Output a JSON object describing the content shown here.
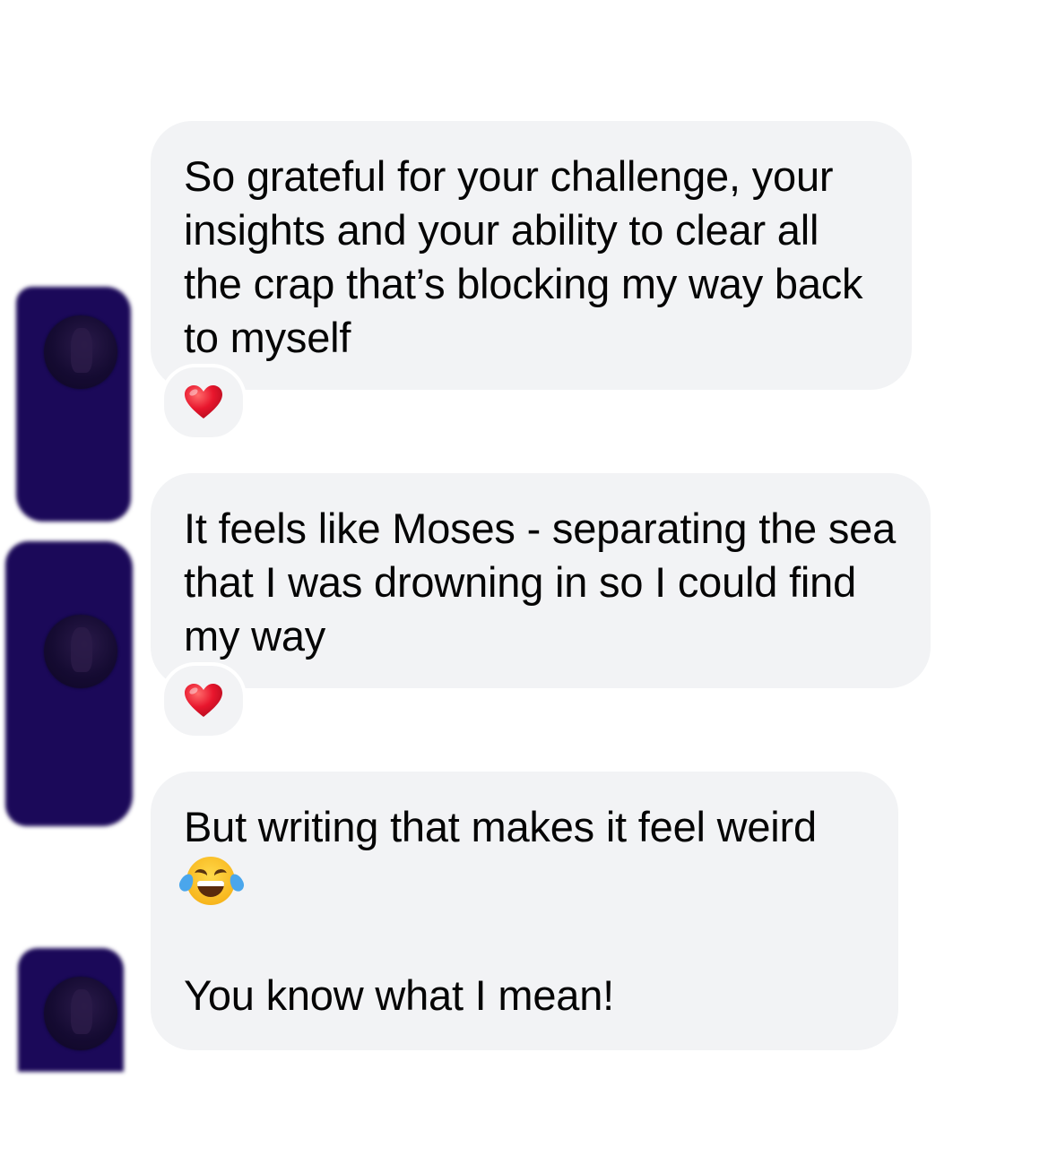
{
  "messages": [
    {
      "text": "So grateful for your challenge, your insights and your ability to clear all the crap that’s blocking my way back to myself",
      "reaction": "heart-icon"
    },
    {
      "text": "It feels like Moses - separating the sea that I was drowning in so I could find my way",
      "reaction": "heart-icon"
    },
    {
      "text_line1": "But writing that makes it feel weird",
      "emoji": "laughing-tears-icon",
      "text_line2": "You know what I mean!"
    }
  ],
  "colors": {
    "bubble": "#f2f3f5",
    "text": "#050505",
    "heart": "#e8162d",
    "redaction": "#1b0959"
  }
}
